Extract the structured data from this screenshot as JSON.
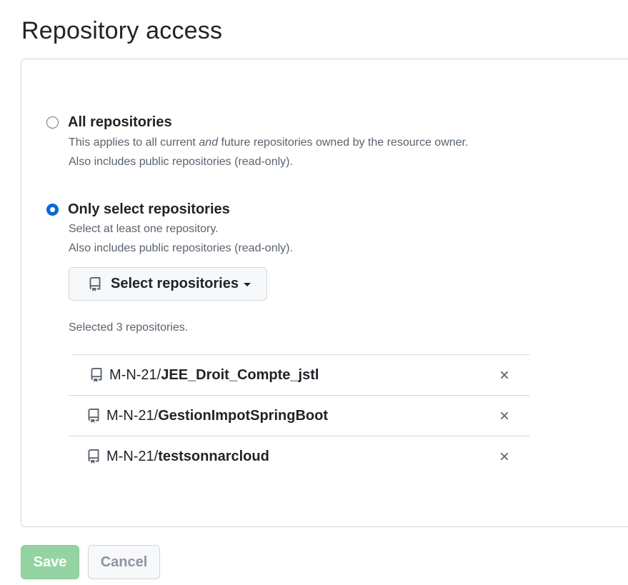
{
  "header": {
    "title": "Repository access"
  },
  "options": {
    "all": {
      "label": "All repositories",
      "desc_before": "This applies to all current ",
      "desc_em": "and",
      "desc_after": " future repositories owned by the resource owner.",
      "desc_line2": "Also includes public repositories (read-only).",
      "checked": false
    },
    "select": {
      "label": "Only select repositories",
      "desc_line1": "Select at least one repository.",
      "desc_line2": "Also includes public repositories (read-only).",
      "checked": true
    }
  },
  "select_button": {
    "label": "Select repositories",
    "icon": "repo-icon"
  },
  "selected_count": "Selected 3 repositories.",
  "repositories": [
    {
      "owner": "M-N-21/",
      "name": "JEE_Droit_Compte_jstl"
    },
    {
      "owner": "M-N-21/",
      "name": "GestionImpotSpringBoot"
    },
    {
      "owner": "M-N-21/",
      "name": "testsonnarcloud"
    }
  ],
  "actions": {
    "save": "Save",
    "cancel": "Cancel"
  },
  "colors": {
    "accent": "#0969da",
    "save_disabled": "#94d3a2",
    "border": "#d0d7de",
    "muted_text": "#59636e"
  }
}
